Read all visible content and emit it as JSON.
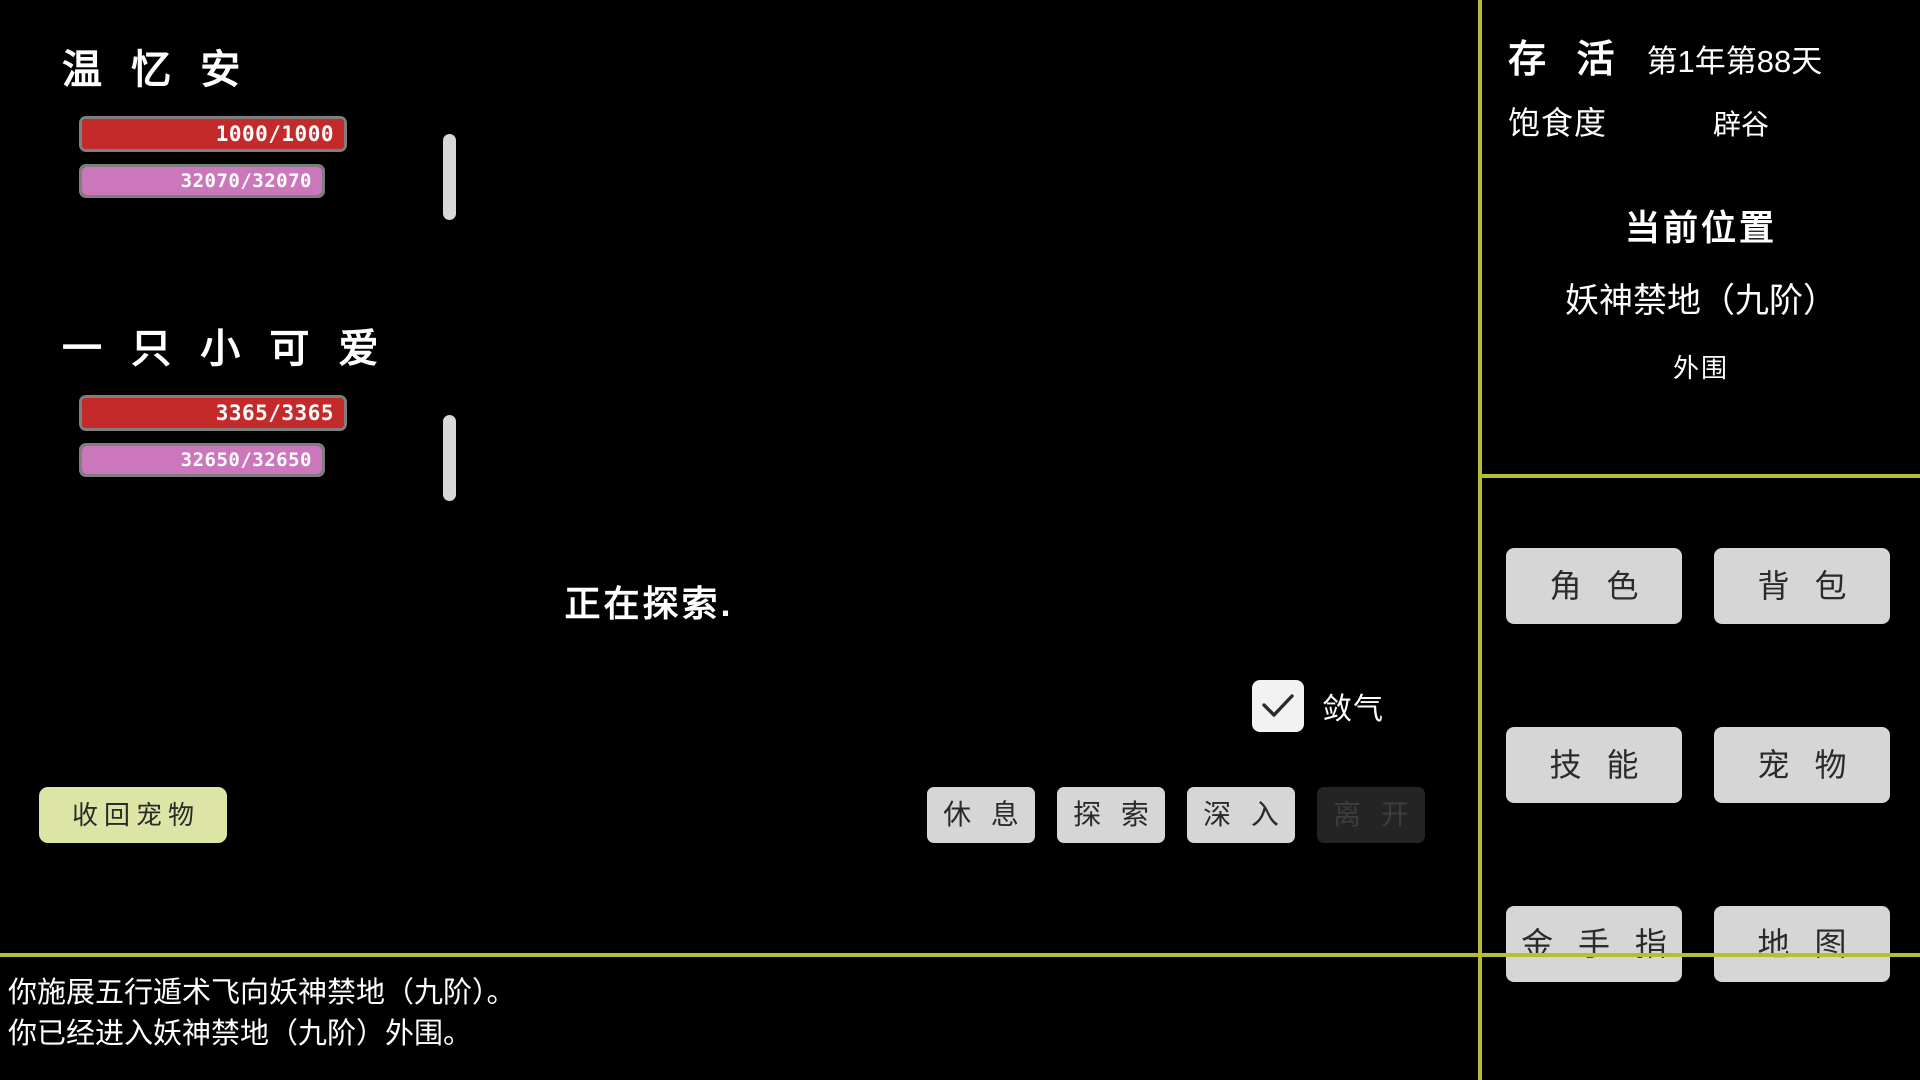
{
  "characters": [
    {
      "name": "温 忆 安",
      "hp": {
        "label": "1000/1000",
        "current": 1000,
        "max": 1000,
        "percent": 100
      },
      "mp": {
        "label": "32070/32070",
        "current": 32070,
        "max": 32070,
        "percent": 100
      }
    },
    {
      "name": "一 只 小 可 爱",
      "hp": {
        "label": "3365/3365",
        "current": 3365,
        "max": 3365,
        "percent": 100
      },
      "mp": {
        "label": "32650/32650",
        "current": 32650,
        "max": 32650,
        "percent": 100
      }
    }
  ],
  "status": {
    "exploring_text": "正在探索."
  },
  "stealth": {
    "label": "敛气",
    "checked": true,
    "icon": "checkmark-icon"
  },
  "actions": {
    "recall_pet_label": "收回宠物",
    "buttons": [
      {
        "label": "休 息",
        "enabled": true
      },
      {
        "label": "探 索",
        "enabled": true
      },
      {
        "label": "深 入",
        "enabled": true
      },
      {
        "label": "离 开",
        "enabled": false
      }
    ]
  },
  "log": {
    "lines": [
      "你施展五行遁术飞向妖神禁地（九阶）。",
      "你已经进入妖神禁地（九阶）外围。"
    ]
  },
  "sidebar": {
    "survival_title": "存 活",
    "survival_day": "第1年第88天",
    "satiety_label": "饱食度",
    "satiety_value": "辟谷",
    "location_title": "当前位置",
    "location_name": "妖神禁地（九阶）",
    "location_area": "外围",
    "menu": [
      {
        "label": "角 色"
      },
      {
        "label": "背 包"
      },
      {
        "label": "技 能"
      },
      {
        "label": "宠 物"
      },
      {
        "label": "金 手 指"
      },
      {
        "label": "地 图"
      }
    ]
  },
  "colors": {
    "background": "#000000",
    "divider": "#b5bd3a",
    "hp_fill": "#c42a2a",
    "mp_fill": "#cc77bb",
    "bar_border": "#7e7e7e",
    "button": "#d6d6d6",
    "button_disabled": "#242424",
    "accent_button": "#dde5a6",
    "text": "#ffffff"
  }
}
